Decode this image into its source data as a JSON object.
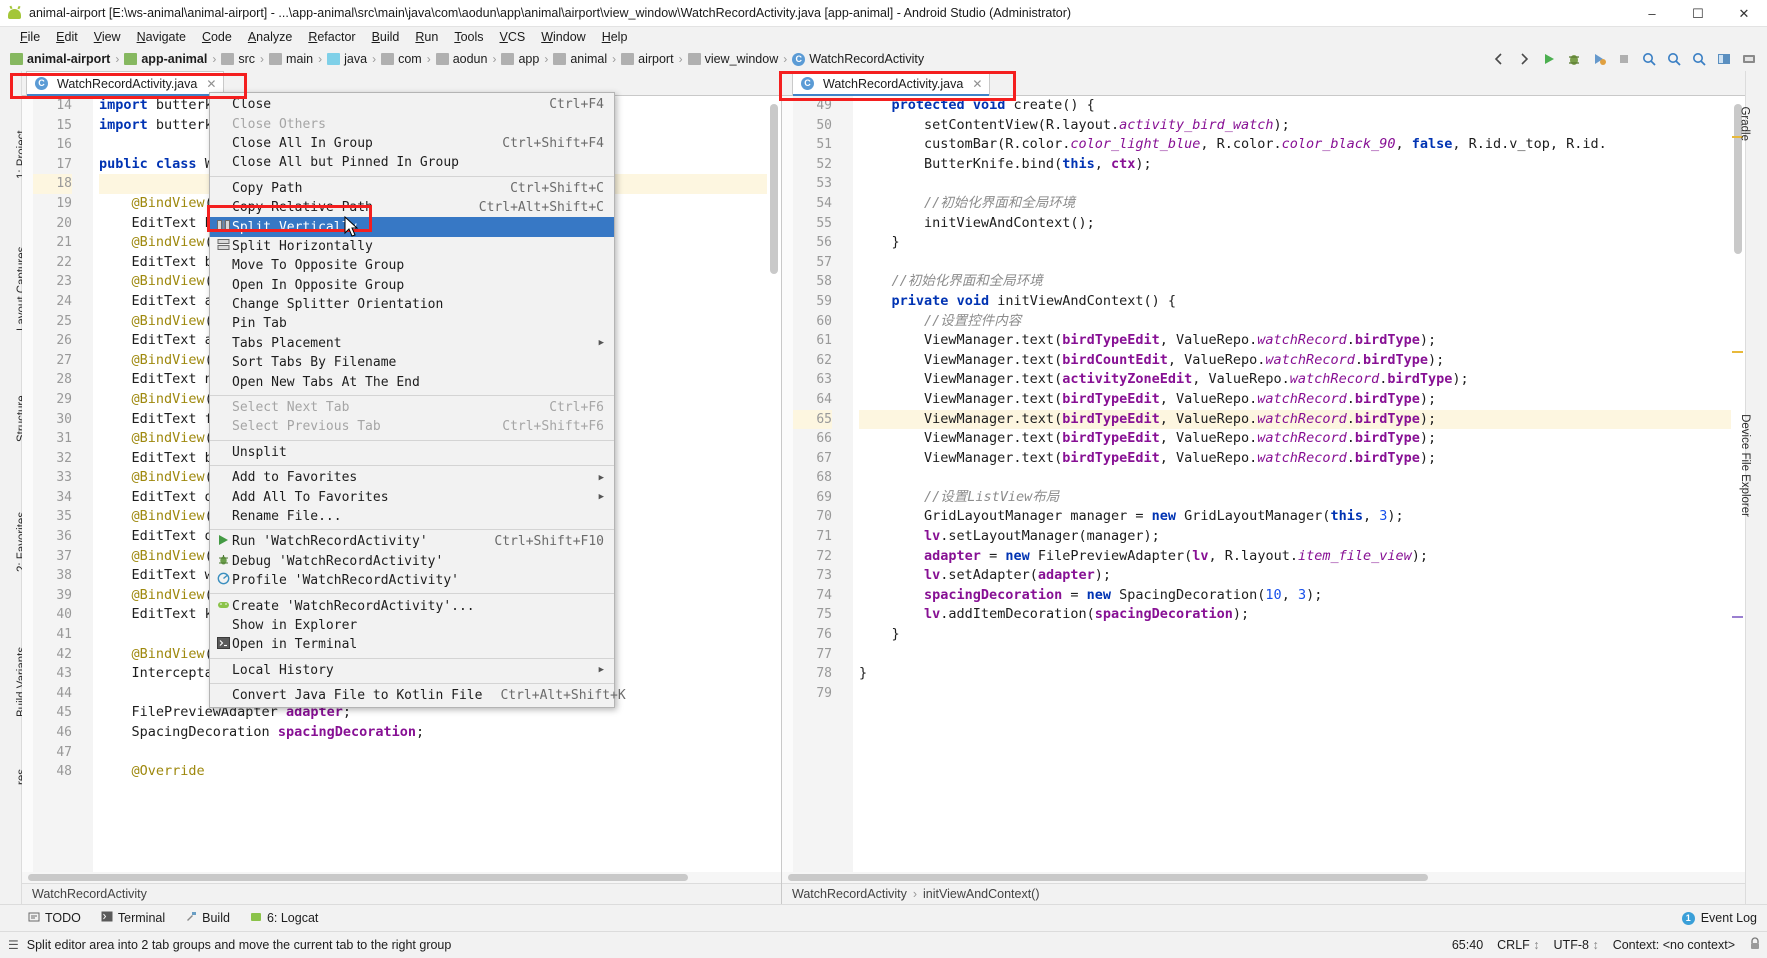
{
  "window": {
    "title": "animal-airport [E:\\ws-animal\\animal-airport] - ...\\app-animal\\src\\main\\java\\com\\aodun\\app\\animal\\airport\\view_window\\WatchRecordActivity.java [app-animal] - Android Studio (Administrator)",
    "icon": "android-icon",
    "minimize": "–",
    "maximize": "☐",
    "close": "✕"
  },
  "menubar": [
    "File",
    "Edit",
    "View",
    "Navigate",
    "Code",
    "Analyze",
    "Refactor",
    "Build",
    "Run",
    "Tools",
    "VCS",
    "Window",
    "Help"
  ],
  "breadcrumb": [
    {
      "label": "animal-airport",
      "icon": "project-icon",
      "bold": true
    },
    {
      "label": "app-animal",
      "icon": "module-icon",
      "bold": true
    },
    {
      "label": "src",
      "icon": "folder-icon",
      "bold": false
    },
    {
      "label": "main",
      "icon": "folder-icon",
      "bold": false
    },
    {
      "label": "java",
      "icon": "source-folder-icon",
      "bold": false
    },
    {
      "label": "com",
      "icon": "package-icon",
      "bold": false
    },
    {
      "label": "aodun",
      "icon": "package-icon",
      "bold": false
    },
    {
      "label": "app",
      "icon": "package-icon",
      "bold": false
    },
    {
      "label": "animal",
      "icon": "package-icon",
      "bold": false
    },
    {
      "label": "airport",
      "icon": "package-icon",
      "bold": false
    },
    {
      "label": "view_window",
      "icon": "package-icon",
      "bold": false
    },
    {
      "label": "WatchRecordActivity",
      "icon": "class-icon",
      "bold": false
    }
  ],
  "toolbar_icons": [
    "back-arrow-icon",
    "forward-arrow-icon",
    "run-icon",
    "debug-icon",
    "coverage-icon",
    "stop-icon",
    "search-everywhere-icon",
    "find-icon",
    "zoom-icon",
    "layout-editor-icon",
    "sdk-manager-icon"
  ],
  "left_strip": [
    {
      "label": "1: Project",
      "name": "tool-window-project"
    },
    {
      "label": "Layout Captures",
      "name": "tool-window-layout-captures"
    },
    {
      "label": "Structure",
      "name": "tool-window-structure"
    },
    {
      "label": "2: Favorites",
      "name": "tool-window-favorites"
    },
    {
      "label": "Build Variants",
      "name": "tool-window-build-variants"
    },
    {
      "label": "res",
      "name": "tool-window-res"
    }
  ],
  "right_strip": [
    {
      "label": "Gradle",
      "name": "tool-window-gradle"
    },
    {
      "label": "Device File Explorer",
      "name": "tool-window-device-file-explorer"
    }
  ],
  "editor_left": {
    "tab": {
      "label": "WatchRecordActivity.java",
      "icon": "java-class-icon",
      "close": "✕"
    },
    "first_line": 14,
    "highlight_line": 18,
    "breadcrumb": "WatchRecordActivity",
    "lines": [
      "import butterkni",
      "import butterkni",
      "",
      "public class Wat",
      "",
      "    @BindView(R.i",
      "    EditText bir",
      "    @BindView(R.i",
      "    EditText bird",
      "    @BindView(R.i",
      "    EditText acti",
      "    @BindView(R.i",
      "    EditText acti",
      "    @BindView(R.i",
      "    EditText nich",
      "    @BindView(R.i",
      "    EditText flig",
      "    @BindView(R.i",
      "    EditText bird",
      "    @BindView(R.i",
      "    EditText driv",
      "    @BindView(R.i",
      "    EditText driv",
      "    @BindView(R.i",
      "    EditText weat",
      "    @BindView(R.i",
      "    EditText kill",
      "",
      "    @BindView(R.i",
      "    InterceptableListView lv;",
      "",
      "    FilePreviewAdapter adapter;",
      "    SpacingDecoration spacingDecoration;",
      "",
      "    @Override"
    ]
  },
  "editor_right": {
    "tab": {
      "label": "WatchRecordActivity.java",
      "icon": "java-class-icon",
      "close": "✕"
    },
    "first_line": 49,
    "highlight_line": 65,
    "breadcrumb_class": "WatchRecordActivity",
    "breadcrumb_method": "initViewAndContext()",
    "lines": [
      "    protected void create() {",
      "        setContentView(R.layout.activity_bird_watch);",
      "        customBar(R.color.color_light_blue, R.color.color_black_90, false, R.id.v_top, R.id.",
      "        ButterKnife.bind(this, ctx);",
      "",
      "        //初始化界面和全局环境",
      "        initViewAndContext();",
      "    }",
      "",
      "    //初始化界面和全局环境",
      "    private void initViewAndContext() {",
      "        //设置控件内容",
      "        ViewManager.text(birdTypeEdit, ValueRepo.watchRecord.birdType);",
      "        ViewManager.text(birdCountEdit, ValueRepo.watchRecord.birdType);",
      "        ViewManager.text(activityZoneEdit, ValueRepo.watchRecord.birdType);",
      "        ViewManager.text(birdTypeEdit, ValueRepo.watchRecord.birdType);",
      "        ViewManager.text(birdTypeEdit, ValueRepo.watchRecord.birdType);",
      "        ViewManager.text(birdTypeEdit, ValueRepo.watchRecord.birdType);",
      "        ViewManager.text(birdTypeEdit, ValueRepo.watchRecord.birdType);",
      "",
      "        //设置ListView布局",
      "        GridLayoutManager manager = new GridLayoutManager(this, 3);",
      "        lv.setLayoutManager(manager);",
      "        adapter = new FilePreviewAdapter(lv, R.layout.item_file_view);",
      "        lv.setAdapter(adapter);",
      "        spacingDecoration = new SpacingDecoration(10, 3);",
      "        lv.addItemDecoration(spacingDecoration);",
      "    }",
      "",
      "}",
      ""
    ]
  },
  "context_menu": {
    "items": [
      {
        "label": "Close",
        "accel": "Ctrl+F4",
        "icon": "",
        "disabled": false,
        "selected": false,
        "submenu": false
      },
      {
        "label": "Close Others",
        "accel": "",
        "icon": "",
        "disabled": true,
        "selected": false,
        "submenu": false
      },
      {
        "label": "Close All In Group",
        "accel": "Ctrl+Shift+F4",
        "icon": "",
        "disabled": false,
        "selected": false,
        "submenu": false
      },
      {
        "label": "Close All but Pinned In Group",
        "accel": "",
        "icon": "",
        "disabled": false,
        "selected": false,
        "submenu": false
      },
      {
        "separator": true
      },
      {
        "label": "Copy Path",
        "accel": "Ctrl+Shift+C",
        "icon": "",
        "disabled": false,
        "selected": false,
        "submenu": false
      },
      {
        "label": "Copy Relative Path",
        "accel": "Ctrl+Alt+Shift+C",
        "icon": "",
        "disabled": false,
        "selected": false,
        "submenu": false
      },
      {
        "label": "Split Vertically",
        "accel": "",
        "icon": "split-vertical-icon",
        "disabled": false,
        "selected": true,
        "submenu": false
      },
      {
        "label": "Split Horizontally",
        "accel": "",
        "icon": "split-horizontal-icon",
        "disabled": false,
        "selected": false,
        "submenu": false
      },
      {
        "label": "Move To Opposite Group",
        "accel": "",
        "icon": "",
        "disabled": false,
        "selected": false,
        "submenu": false
      },
      {
        "label": "Open In Opposite Group",
        "accel": "",
        "icon": "",
        "disabled": false,
        "selected": false,
        "submenu": false
      },
      {
        "label": "Change Splitter Orientation",
        "accel": "",
        "icon": "",
        "disabled": false,
        "selected": false,
        "submenu": false
      },
      {
        "label": "Pin Tab",
        "accel": "",
        "icon": "",
        "disabled": false,
        "selected": false,
        "submenu": false
      },
      {
        "label": "Tabs Placement",
        "accel": "",
        "icon": "",
        "disabled": false,
        "selected": false,
        "submenu": true
      },
      {
        "label": "Sort Tabs By Filename",
        "accel": "",
        "icon": "",
        "disabled": false,
        "selected": false,
        "submenu": false
      },
      {
        "label": "Open New Tabs At The End",
        "accel": "",
        "icon": "",
        "disabled": false,
        "selected": false,
        "submenu": false
      },
      {
        "separator": true
      },
      {
        "label": "Select Next Tab",
        "accel": "Ctrl+F6",
        "icon": "",
        "disabled": true,
        "selected": false,
        "submenu": false
      },
      {
        "label": "Select Previous Tab",
        "accel": "Ctrl+Shift+F6",
        "icon": "",
        "disabled": true,
        "selected": false,
        "submenu": false
      },
      {
        "separator": true
      },
      {
        "label": "Unsplit",
        "accel": "",
        "icon": "",
        "disabled": false,
        "selected": false,
        "submenu": false
      },
      {
        "separator": true
      },
      {
        "label": "Add to Favorites",
        "accel": "",
        "icon": "",
        "disabled": false,
        "selected": false,
        "submenu": true
      },
      {
        "label": "Add All To Favorites",
        "accel": "",
        "icon": "",
        "disabled": false,
        "selected": false,
        "submenu": true
      },
      {
        "label": "Rename File...",
        "accel": "",
        "icon": "",
        "disabled": false,
        "selected": false,
        "submenu": false
      },
      {
        "separator": true
      },
      {
        "label": "Run 'WatchRecordActivity'",
        "accel": "Ctrl+Shift+F10",
        "icon": "run-icon",
        "disabled": false,
        "selected": false,
        "submenu": false
      },
      {
        "label": "Debug 'WatchRecordActivity'",
        "accel": "",
        "icon": "debug-icon",
        "disabled": false,
        "selected": false,
        "submenu": false
      },
      {
        "label": "Profile 'WatchRecordActivity'",
        "accel": "",
        "icon": "profile-icon",
        "disabled": false,
        "selected": false,
        "submenu": false
      },
      {
        "separator": true
      },
      {
        "label": "Create 'WatchRecordActivity'...",
        "accel": "",
        "icon": "android-run-config-icon",
        "disabled": false,
        "selected": false,
        "submenu": false
      },
      {
        "label": "Show in Explorer",
        "accel": "",
        "icon": "",
        "disabled": false,
        "selected": false,
        "submenu": false
      },
      {
        "label": "Open in Terminal",
        "accel": "",
        "icon": "terminal-icon",
        "disabled": false,
        "selected": false,
        "submenu": false
      },
      {
        "separator": true
      },
      {
        "label": "Local History",
        "accel": "",
        "icon": "",
        "disabled": false,
        "selected": false,
        "submenu": true
      },
      {
        "separator": true
      },
      {
        "label": "Convert Java File to Kotlin File",
        "accel": "Ctrl+Alt+Shift+K",
        "icon": "",
        "disabled": false,
        "selected": false,
        "submenu": false
      }
    ]
  },
  "bottom_toolwindows": [
    {
      "label": "TODO",
      "icon": "todo-icon"
    },
    {
      "label": "Terminal",
      "icon": "terminal-icon"
    },
    {
      "label": "Build",
      "icon": "build-icon"
    },
    {
      "label": "6: Logcat",
      "icon": "logcat-icon"
    }
  ],
  "event_log": {
    "label": "Event Log",
    "badge": "1"
  },
  "statusbar": {
    "message": "Split editor area into 2 tab groups and move the current tab to the right group",
    "caret": "65:40",
    "line_separator": "CRLF",
    "encoding": "UTF-8",
    "context": "Context: <no context>"
  },
  "colors": {
    "accent_blue": "#3778c5",
    "annotation_red": "#f41f1f",
    "highlight_yellow": "#fdf6e0",
    "keyword_blue": "#0033b3",
    "field_purple": "#871094",
    "comment_gray": "#8c8c8c",
    "number_blue": "#1750eb"
  }
}
